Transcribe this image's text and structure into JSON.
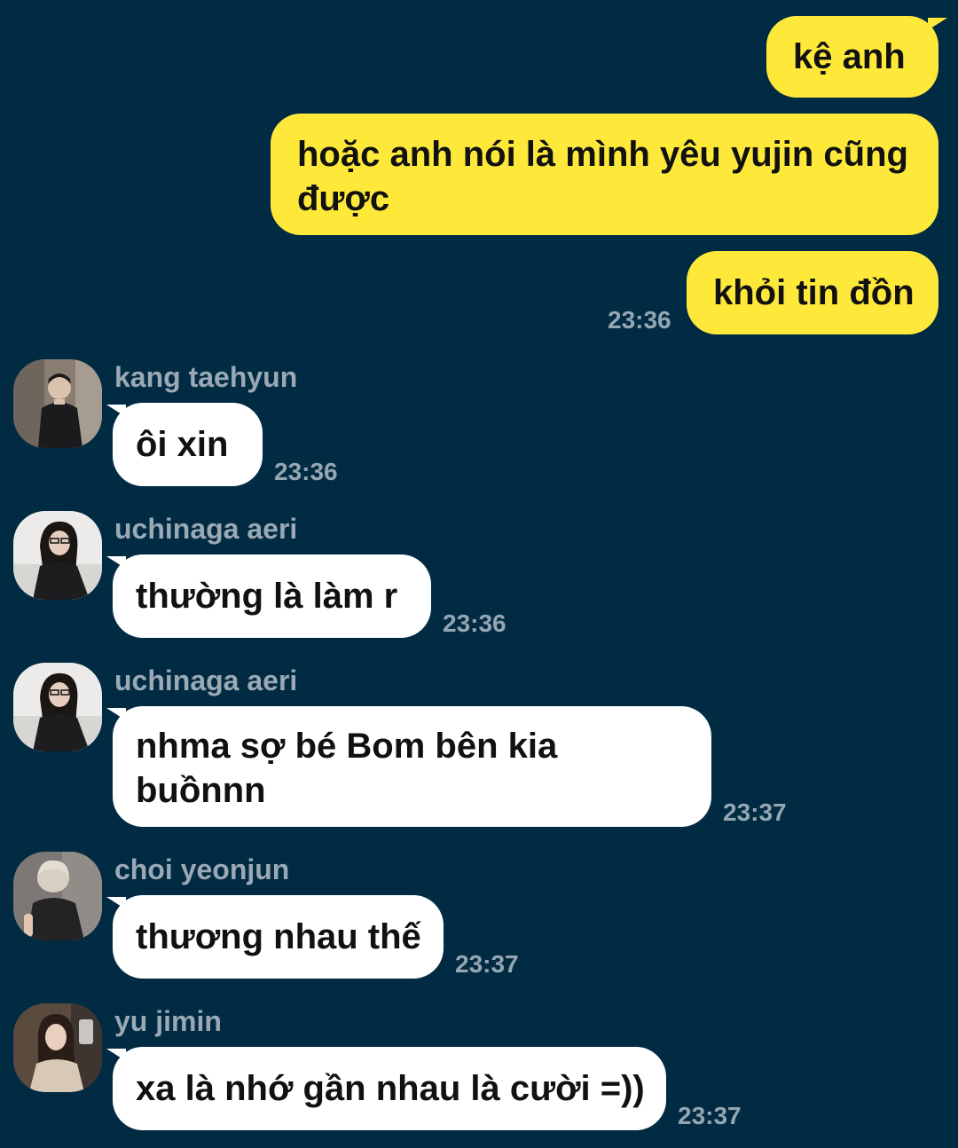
{
  "colors": {
    "background": "#012a43",
    "outgoing_bubble": "#fee93b",
    "incoming_bubble": "#ffffff",
    "timestamp": "#95a6b3",
    "sender_name": "#9aa9b4"
  },
  "outgoing": [
    {
      "text": "kệ anh"
    },
    {
      "text": "hoặc anh nói là mình yêu yujin cũng được"
    },
    {
      "text": "khỏi tin đồn",
      "time": "23:36"
    }
  ],
  "incoming": [
    {
      "sender": "kang taehyun",
      "text": "ôi xin",
      "time": "23:36",
      "avatar": "avatar-photo"
    },
    {
      "sender": "uchinaga aeri",
      "text": "thường là làm r",
      "time": "23:36",
      "avatar": "avatar-photo"
    },
    {
      "sender": "uchinaga aeri",
      "text": "nhma sợ bé Bom bên kia buồnnn",
      "time": "23:37",
      "avatar": "avatar-photo"
    },
    {
      "sender": "choi yeonjun",
      "text": "thương nhau thế",
      "time": "23:37",
      "avatar": "avatar-photo"
    },
    {
      "sender": "yu jimin",
      "text": "xa là nhớ gần nhau là cười =))",
      "time": "23:37",
      "avatar": "avatar-photo"
    }
  ]
}
